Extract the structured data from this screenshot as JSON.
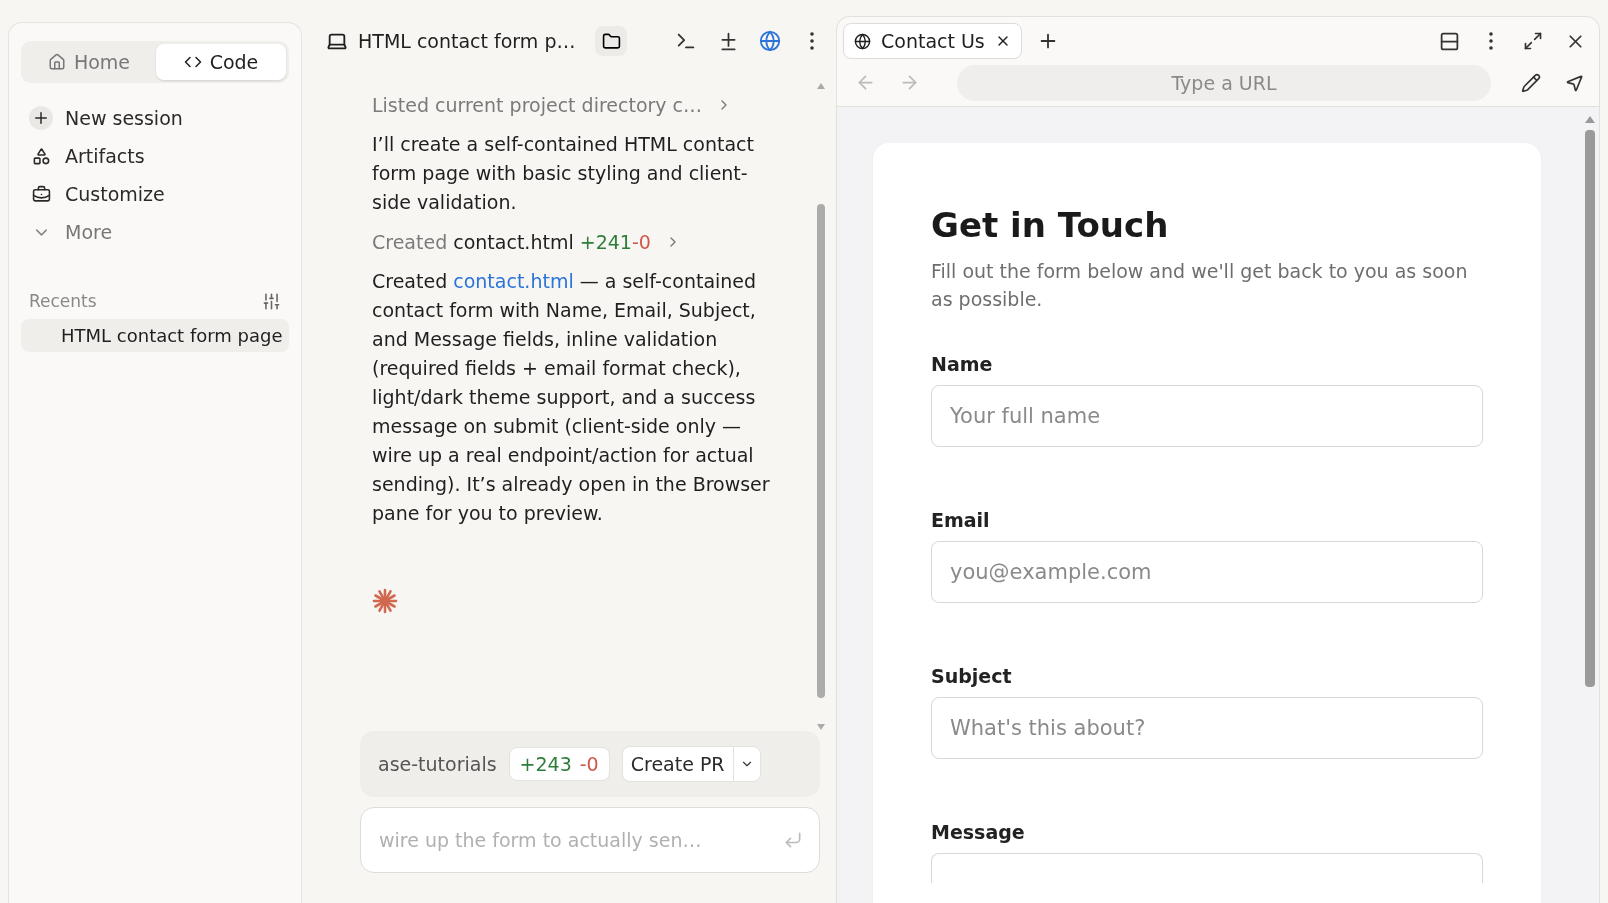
{
  "sidebar": {
    "mode_tabs": [
      {
        "label": "Home",
        "selected": false
      },
      {
        "label": "Code",
        "selected": true
      }
    ],
    "nav_items": [
      {
        "label": "New session",
        "kind": "new"
      },
      {
        "label": "Artifacts",
        "kind": "artifacts"
      },
      {
        "label": "Customize",
        "kind": "customize"
      },
      {
        "label": "More",
        "kind": "more"
      }
    ],
    "recents": {
      "title": "Recents",
      "items": [
        {
          "label": "HTML contact form page",
          "selected": true
        }
      ]
    }
  },
  "chat": {
    "title": "HTML contact form p…",
    "messages": [
      {
        "kind": "tool",
        "text": "Listed current project directory c…"
      },
      {
        "kind": "text",
        "text": "I’ll create a self-contained HTML contact form page with basic styling and client-side validation."
      },
      {
        "kind": "created",
        "verb": "Created",
        "file": "contact.html",
        "added": "+241",
        "removed": "-0"
      },
      {
        "kind": "summary",
        "before": "Created",
        "link": "contact.html",
        "after": "— a self-contained contact form with Name, Email, Subject, and Message fields, inline validation (required fields + email format check), light/dark theme support, and a success message on submit (client-side only — wire up a real endpoint/action for actual sending). It’s already open in the Browser pane for you to preview."
      }
    ],
    "thinking": true,
    "branch_bar": {
      "branch": "ase-tutorials",
      "added": "+243",
      "removed": "-0",
      "button": "Create PR"
    },
    "input": {
      "placeholder": "wire up the form to actually sen…"
    }
  },
  "browser": {
    "tab": {
      "label": "Contact Us"
    },
    "url": {
      "placeholder": "Type a URL"
    },
    "page": {
      "heading": "Get in Touch",
      "subtitle": "Fill out the form below and we'll get back to you as soon as possible.",
      "fields": [
        {
          "label": "Name",
          "placeholder": "Your full name"
        },
        {
          "label": "Email",
          "placeholder": "you@example.com"
        },
        {
          "label": "Subject",
          "placeholder": "What's this about?"
        },
        {
          "label": "Message"
        }
      ]
    }
  }
}
